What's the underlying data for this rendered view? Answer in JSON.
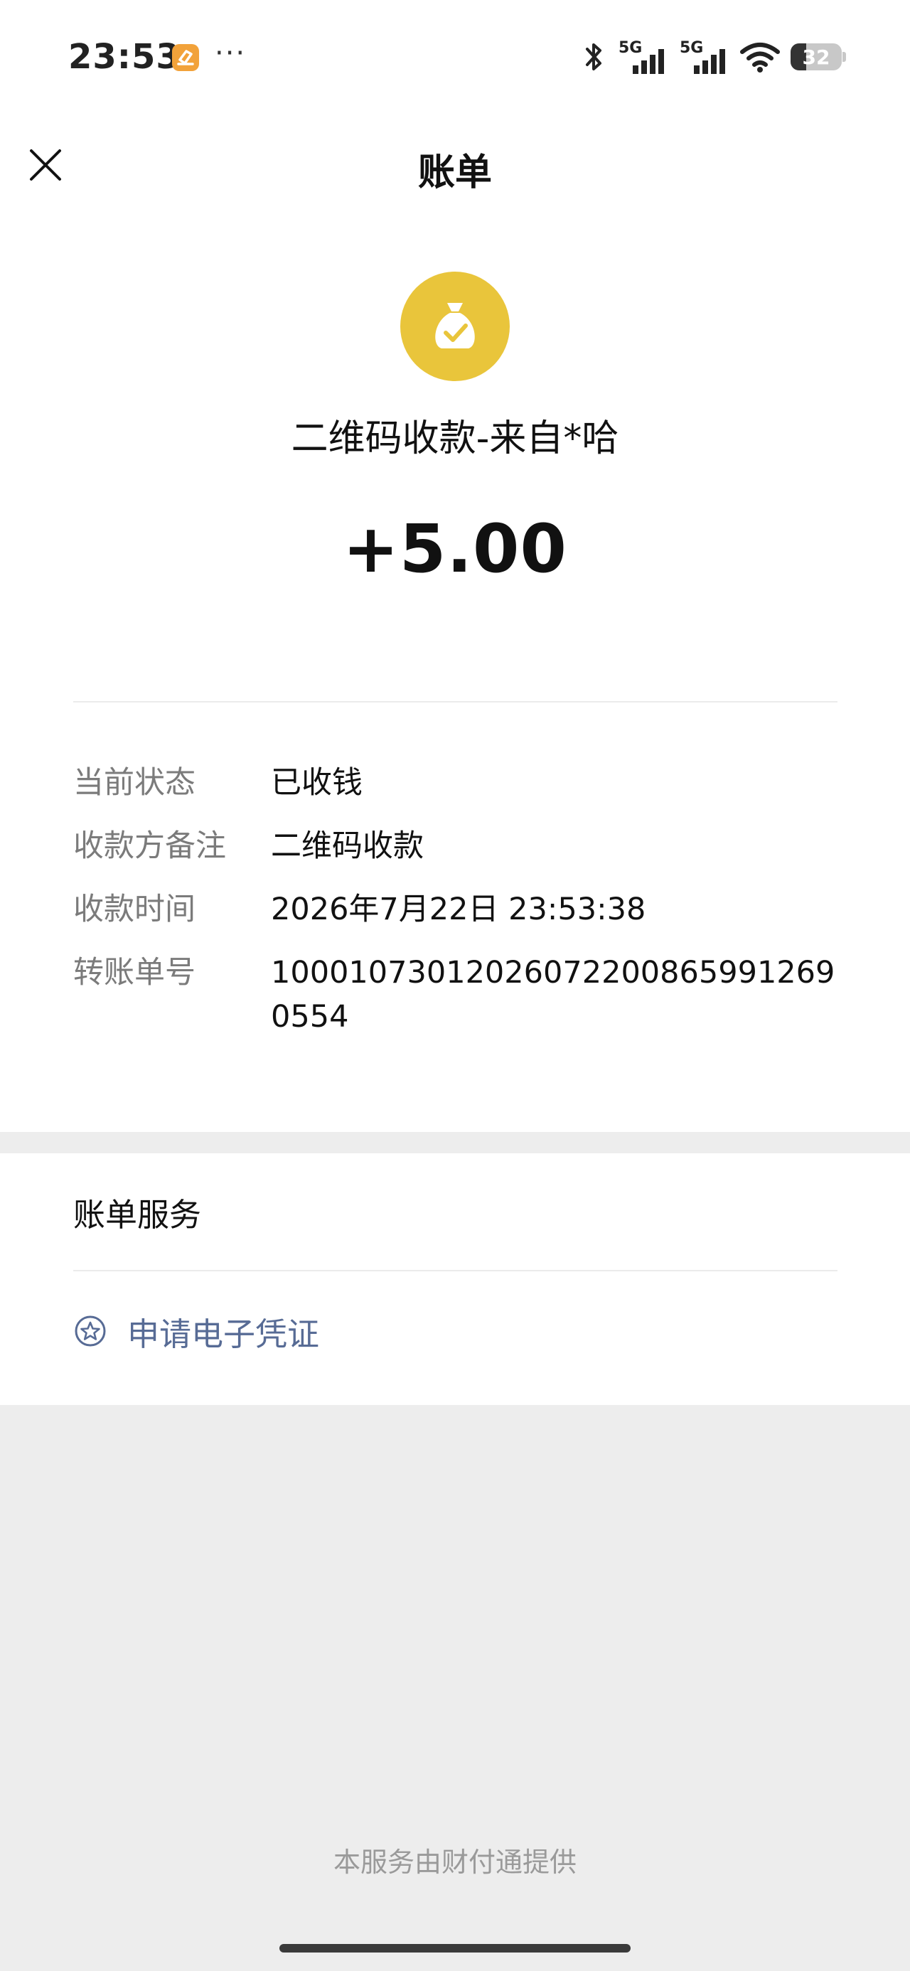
{
  "status_bar": {
    "time": "23:53",
    "more": "···",
    "network_1": "5G",
    "network_2": "5G",
    "battery": "32"
  },
  "nav": {
    "title": "账单"
  },
  "transaction": {
    "title": "二维码收款-来自*哈",
    "amount": "+5.00"
  },
  "details": {
    "status_label": "当前状态",
    "status_value": "已收钱",
    "remark_label": "收款方备注",
    "remark_value": "二维码收款",
    "time_label": "收款时间",
    "time_value": "2026年7月22日 23:53:38",
    "order_label": "转账单号",
    "order_value": "100010730120260722008659912690554"
  },
  "service": {
    "heading": "账单服务",
    "voucher_label": "申请电子凭证"
  },
  "footer": {
    "note": "本服务由财付通提供"
  },
  "colors": {
    "accent_link": "#576b95",
    "money_icon": "#e9c53b",
    "app_notification": "#f2a23a"
  }
}
